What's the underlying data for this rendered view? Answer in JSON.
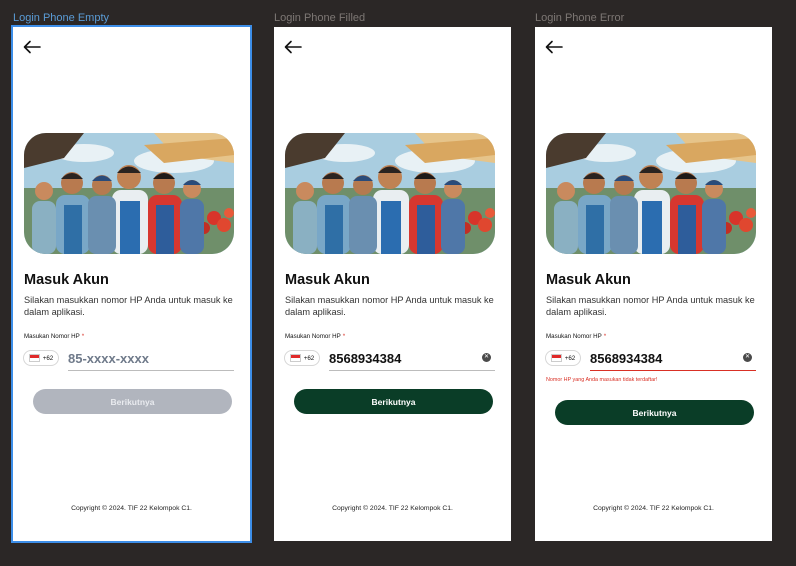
{
  "frames": [
    {
      "label": "Login Phone Empty",
      "title": "Masuk Akun",
      "subtitle": "Silakan masukkan nomor HP Anda untuk masuk ke dalam aplikasi.",
      "field_label": "Masukan Nomor HP",
      "required_mark": "*",
      "country_code": "+62",
      "phone_value": "",
      "phone_placeholder": "85-xxxx-xxxx",
      "button_label": "Berikutnya",
      "button_state": "disabled",
      "copyright": "Copyright © 2024. TIF 22 Kelompok C1."
    },
    {
      "label": "Login Phone Filled",
      "title": "Masuk Akun",
      "subtitle": "Silakan masukkan nomor HP Anda untuk masuk ke dalam aplikasi.",
      "field_label": "Masukan Nomor HP",
      "required_mark": "*",
      "country_code": "+62",
      "phone_value": "8568934384",
      "button_label": "Berikutnya",
      "button_state": "enabled",
      "copyright": "Copyright © 2024. TIF 22 Kelompok C1."
    },
    {
      "label": "Login Phone Error",
      "title": "Masuk Akun",
      "subtitle": "Silakan masukkan nomor HP Anda untuk masuk ke dalam aplikasi.",
      "field_label": "Masukan Nomor HP",
      "required_mark": "*",
      "country_code": "+62",
      "phone_value": "8568934384",
      "error_message": "Nomor HP yang Anda masukan tidak terdaftar!",
      "button_label": "Berikutnya",
      "button_state": "enabled",
      "copyright": "Copyright © 2024. TIF 22 Kelompok C1."
    }
  ],
  "colors": {
    "canvas_bg": "#2b2726",
    "primary_button": "#0a3d27",
    "disabled_button": "#b1b5be",
    "error": "#d93025",
    "selection": "#3d8ee8"
  },
  "icons": {
    "back": "arrow-left-icon",
    "clear": "close-circle-icon",
    "flag": "indonesia-flag-icon"
  }
}
